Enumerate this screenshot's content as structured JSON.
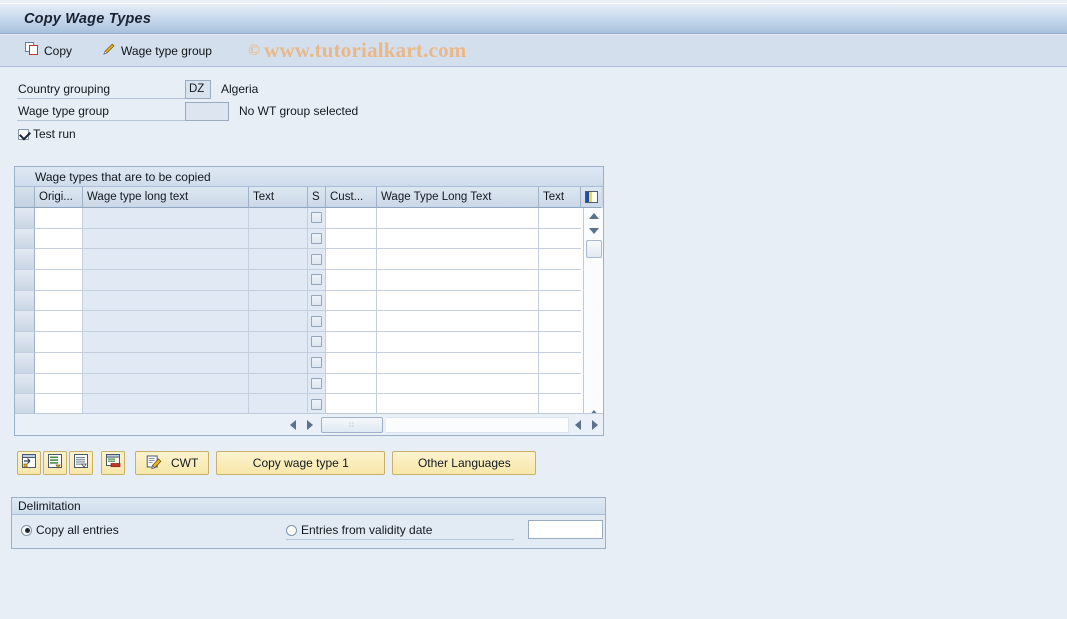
{
  "window": {
    "title": "Copy Wage Types"
  },
  "toolbar": {
    "copy_label": "Copy",
    "wage_type_group_label": "Wage type group",
    "watermark_mark": "©",
    "watermark_text": "www.tutorialkart.com"
  },
  "form": {
    "country_grouping_label": "Country grouping",
    "country_grouping_value": "DZ",
    "country_grouping_desc": "Algeria",
    "wage_type_group_label": "Wage type group",
    "wage_type_group_value": "",
    "wage_type_group_desc": "No WT group selected",
    "test_run_label": "Test run",
    "test_run_checked": true
  },
  "table": {
    "caption": "Wage types that are to be copied",
    "columns": [
      {
        "key": "select",
        "label": ""
      },
      {
        "key": "origin",
        "label": "Origi..."
      },
      {
        "key": "wage_type_long_text",
        "label": "Wage type long text"
      },
      {
        "key": "text1",
        "label": "Text"
      },
      {
        "key": "s",
        "label": "S"
      },
      {
        "key": "cust",
        "label": "Cust..."
      },
      {
        "key": "wage_type_long_text_2",
        "label": "Wage Type Long Text"
      },
      {
        "key": "text2",
        "label": "Text"
      },
      {
        "key": "config",
        "label": ""
      }
    ],
    "rows": [
      {
        "origin": "",
        "wage_type_long_text": "",
        "text1": "",
        "s": false,
        "cust": "",
        "wage_type_long_text_2": "",
        "text2": ""
      },
      {
        "origin": "",
        "wage_type_long_text": "",
        "text1": "",
        "s": false,
        "cust": "",
        "wage_type_long_text_2": "",
        "text2": ""
      },
      {
        "origin": "",
        "wage_type_long_text": "",
        "text1": "",
        "s": false,
        "cust": "",
        "wage_type_long_text_2": "",
        "text2": ""
      },
      {
        "origin": "",
        "wage_type_long_text": "",
        "text1": "",
        "s": false,
        "cust": "",
        "wage_type_long_text_2": "",
        "text2": ""
      },
      {
        "origin": "",
        "wage_type_long_text": "",
        "text1": "",
        "s": false,
        "cust": "",
        "wage_type_long_text_2": "",
        "text2": ""
      },
      {
        "origin": "",
        "wage_type_long_text": "",
        "text1": "",
        "s": false,
        "cust": "",
        "wage_type_long_text_2": "",
        "text2": ""
      },
      {
        "origin": "",
        "wage_type_long_text": "",
        "text1": "",
        "s": false,
        "cust": "",
        "wage_type_long_text_2": "",
        "text2": ""
      },
      {
        "origin": "",
        "wage_type_long_text": "",
        "text1": "",
        "s": false,
        "cust": "",
        "wage_type_long_text_2": "",
        "text2": ""
      },
      {
        "origin": "",
        "wage_type_long_text": "",
        "text1": "",
        "s": false,
        "cust": "",
        "wage_type_long_text_2": "",
        "text2": ""
      },
      {
        "origin": "",
        "wage_type_long_text": "",
        "text1": "",
        "s": false,
        "cust": "",
        "wage_type_long_text_2": "",
        "text2": ""
      }
    ],
    "scroll_thumb_dots": "∷"
  },
  "actions": {
    "icon_buttons": [
      {
        "name": "insert-entry-icon",
        "tooltip": ""
      },
      {
        "name": "copy-entry-icon",
        "tooltip": ""
      },
      {
        "name": "select-all-icon",
        "tooltip": ""
      },
      {
        "name": "delete-entry-icon",
        "tooltip": ""
      }
    ],
    "cwt_label": "CWT",
    "copy_wage_type_label": "Copy wage type 1",
    "other_languages_label": "Other Languages"
  },
  "delimitation": {
    "title": "Delimitation",
    "copy_all_entries_label": "Copy all entries",
    "copy_all_entries_selected": true,
    "entries_from_validity_date_label": "Entries from validity date",
    "entries_from_validity_date_selected": false,
    "validity_date_value": ""
  },
  "colors": {
    "title_bar": "#b9cde5",
    "toolbar": "#d3dfed",
    "page_background": "#e8eef6",
    "button_yellow": "#f7e7a9",
    "watermark": "#eab886",
    "panel_border": "#9bb0c8"
  }
}
